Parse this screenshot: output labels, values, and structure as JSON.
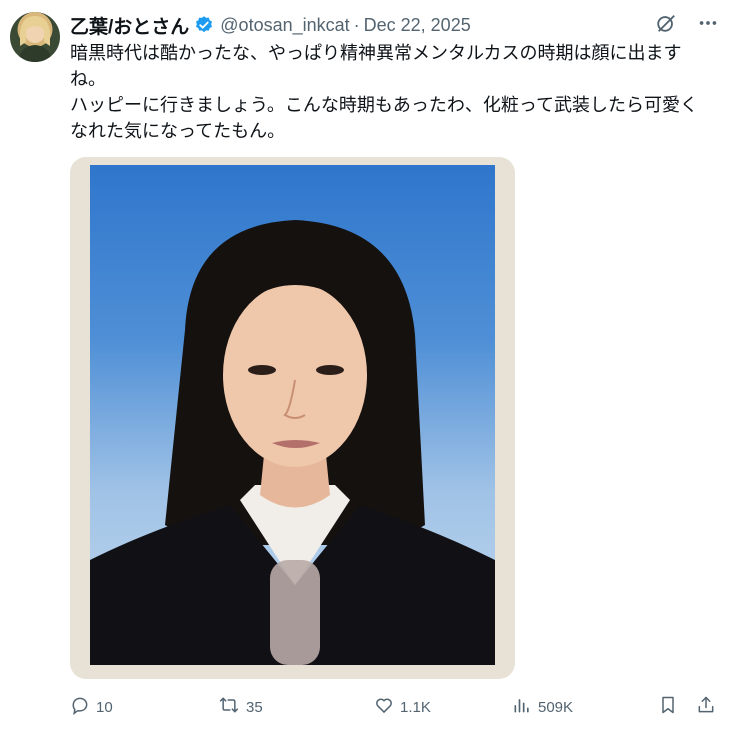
{
  "author": {
    "name": "乙葉/おとさん",
    "handle": "@otosan_inkcat",
    "date": "Dec 22, 2025",
    "separator": "·"
  },
  "tweet": {
    "text": "暗黒時代は酷かったな、やっぱり精神異常メンタルカスの時期は顔に出ますね。\nハッピーに行きましょう。こんな時期もあったわ、化粧って武装したら可愛くなれた気になってたもん。"
  },
  "stats": {
    "replies": "10",
    "reposts": "35",
    "likes": "1.1K",
    "views": "509K"
  },
  "colors": {
    "verified": "#1d9bf0",
    "muted": "#536471",
    "text": "#0f1419"
  },
  "icons": {
    "grok": "grok-icon",
    "more": "more-icon",
    "reply": "reply-icon",
    "repost": "repost-icon",
    "like": "like-icon",
    "views": "views-icon",
    "bookmark": "bookmark-icon",
    "share": "share-icon"
  }
}
